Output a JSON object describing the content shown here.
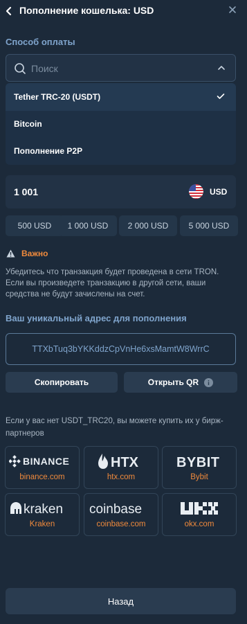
{
  "header": {
    "title": "Пополнение кошелька: USD"
  },
  "payment_method": {
    "label": "Способ оплаты",
    "search_placeholder": "Поиск",
    "options": [
      {
        "label": "Tether TRC-20 (USDT)",
        "selected": true
      },
      {
        "label": "Bitcoin",
        "selected": false
      },
      {
        "label": "Пополнение P2P",
        "selected": false
      }
    ]
  },
  "amount": {
    "value": "1 001",
    "currency": "USD",
    "presets": [
      "500 USD",
      "1 000 USD",
      "2 000 USD",
      "5 000 USD"
    ]
  },
  "warning": {
    "title": "Важно",
    "text": "Убедитесь что транзакция будет проведена в сети TRON. Если вы произведете транзакцию в другой сети, ваши средства не будут зачислены на счет."
  },
  "address": {
    "label": "Ваш уникальный адрес для пополнения",
    "value": "TTXbTuq3bYKKddzCpVnHe6xsMamtW8WrrC",
    "copy_label": "Скопировать",
    "qr_label": "Открыть QR"
  },
  "partners": {
    "text": "Если у вас нет USDT_TRC20, вы можете купить их у бирж-партнеров",
    "items": [
      {
        "logo": "BINANCE",
        "label": "binance.com",
        "icon": "binance-icon"
      },
      {
        "logo": "HTX",
        "label": "htx.com",
        "icon": "htx-icon"
      },
      {
        "logo": "BYBIT",
        "label": "Bybit",
        "icon": "bybit-icon"
      },
      {
        "logo": "kraken",
        "label": "Kraken",
        "icon": "kraken-icon"
      },
      {
        "logo": "coinbase",
        "label": "coinbase.com",
        "icon": "coinbase-icon"
      },
      {
        "logo": "OKX",
        "label": "okx.com",
        "icon": "okx-icon"
      }
    ]
  },
  "footer": {
    "back_label": "Назад"
  },
  "colors": {
    "background": "#1c2a3a",
    "accent_orange": "#f08a3c",
    "accent_blue": "#7fa4cc"
  }
}
